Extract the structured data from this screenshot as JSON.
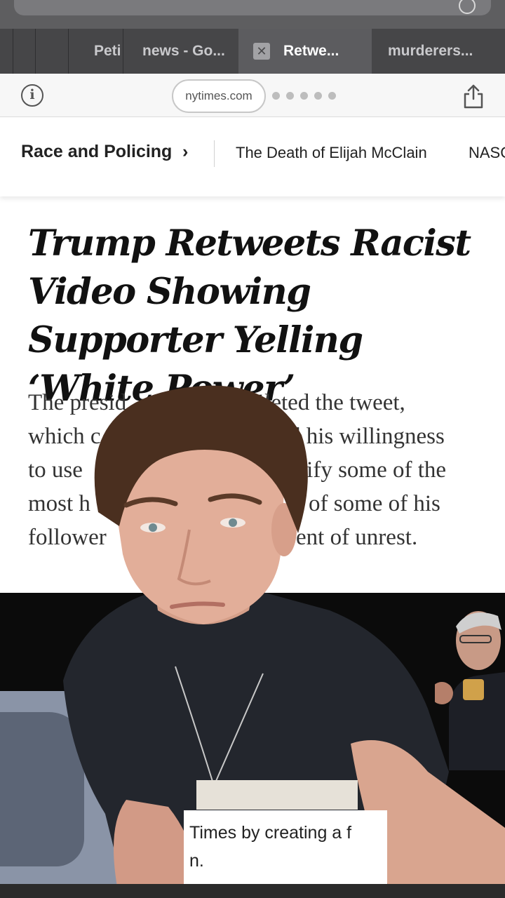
{
  "browser": {
    "tabs": [
      {
        "label": "Peti",
        "active": false
      },
      {
        "label": "news - Go...",
        "active": false
      },
      {
        "label": "Retwe...",
        "active": true
      },
      {
        "label": "murderers...",
        "active": false
      }
    ],
    "domain": "nytimes.com"
  },
  "section_nav": {
    "primary": "Race and Policing",
    "items": [
      "The Death of Elijah McClain",
      "NASC"
    ]
  },
  "article": {
    "headline": "Trump Retweets Racist Video Showing Supporter Yelling ‘White Power’",
    "summary_visible": [
      "The presid",
      "deleted the tweet,",
      "which c",
      "d his willingness",
      "to use",
      "lify some of the",
      "most h",
      "of some of his",
      "follower",
      "ent of unrest."
    ]
  },
  "caption": {
    "line1": "Times by creating a f",
    "line2": "n."
  },
  "colors": {
    "chrome_dark": "#464648",
    "chrome_tab_active": "#5c5c5f",
    "toolbar_bg": "#f7f7f7",
    "headline_text": "#111111",
    "photo_bg": "#0b0b0b"
  }
}
